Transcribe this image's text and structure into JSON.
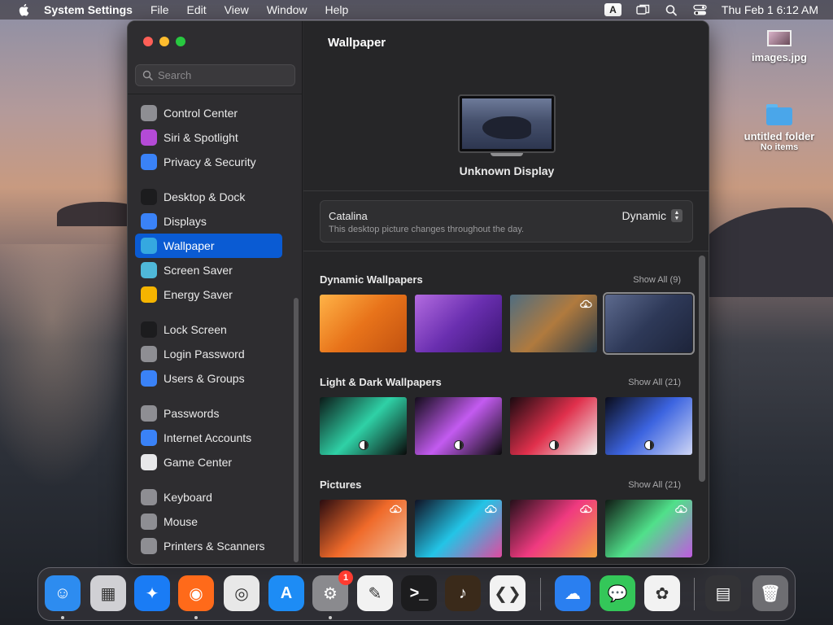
{
  "menubar": {
    "app_name": "System Settings",
    "items": [
      "File",
      "Edit",
      "View",
      "Window",
      "Help"
    ],
    "input_source": "A",
    "clock": "Thu Feb 1  6:12 AM"
  },
  "desktop": {
    "image_file": "images.jpg",
    "folder_name": "untitled folder",
    "folder_sub": "No items"
  },
  "sidebar": {
    "search_placeholder": "Search",
    "items": [
      {
        "label": "Control Center",
        "icon": "toggles-icon",
        "color": "#8e8e93"
      },
      {
        "label": "Siri & Spotlight",
        "icon": "siri-icon",
        "color": "#b44ad6"
      },
      {
        "label": "Privacy & Security",
        "icon": "hand-icon",
        "color": "#3a82f7"
      },
      {
        "label": "Desktop & Dock",
        "icon": "dock-icon",
        "color": "#1c1c1e"
      },
      {
        "label": "Displays",
        "icon": "sun-icon",
        "color": "#3a82f7"
      },
      {
        "label": "Wallpaper",
        "icon": "flower-icon",
        "color": "#35a8e0",
        "active": true
      },
      {
        "label": "Screen Saver",
        "icon": "screen-saver-icon",
        "color": "#4fb8d8"
      },
      {
        "label": "Energy Saver",
        "icon": "bulb-icon",
        "color": "#f5b400"
      },
      {
        "label": "Lock Screen",
        "icon": "lock-icon",
        "color": "#1c1c1e"
      },
      {
        "label": "Login Password",
        "icon": "lock-icon",
        "color": "#8e8e93"
      },
      {
        "label": "Users & Groups",
        "icon": "users-icon",
        "color": "#3a82f7"
      },
      {
        "label": "Passwords",
        "icon": "key-icon",
        "color": "#8e8e93"
      },
      {
        "label": "Internet Accounts",
        "icon": "at-icon",
        "color": "#3a82f7"
      },
      {
        "label": "Game Center",
        "icon": "game-center-icon",
        "color": "#e8e8ea"
      },
      {
        "label": "Keyboard",
        "icon": "keyboard-icon",
        "color": "#8e8e93"
      },
      {
        "label": "Mouse",
        "icon": "mouse-icon",
        "color": "#8e8e93"
      },
      {
        "label": "Printers & Scanners",
        "icon": "printer-icon",
        "color": "#8e8e93"
      }
    ]
  },
  "main": {
    "title": "Wallpaper",
    "display_name": "Unknown Display",
    "current": {
      "name": "Catalina",
      "description": "This desktop picture changes throughout the day.",
      "mode": "Dynamic"
    },
    "sections": [
      {
        "title": "Dynamic Wallpapers",
        "show_all": "Show All (9)",
        "thumbs": [
          {
            "name": "ventura-orange",
            "colors": [
              "#ffb347",
              "#e8731a",
              "#c25210"
            ]
          },
          {
            "name": "monterey-purple",
            "colors": [
              "#b36be0",
              "#6a2fb0",
              "#3a1472"
            ]
          },
          {
            "name": "big-sur-coast",
            "colors": [
              "#4f6d80",
              "#b07a3e",
              "#283a48"
            ],
            "download": true
          },
          {
            "name": "catalina",
            "colors": [
              "#5d6a8e",
              "#2e3958",
              "#1d243a"
            ],
            "selected": true
          }
        ]
      },
      {
        "title": "Light & Dark Wallpapers",
        "show_all": "Show All (21)",
        "thumbs": [
          {
            "name": "mac-pro-green",
            "colors": [
              "#0c1a18",
              "#2fd1a6",
              "#0a0a0a"
            ],
            "mode": true
          },
          {
            "name": "mac-pro-purple",
            "colors": [
              "#130c1a",
              "#c35bf0",
              "#0a0a0a"
            ],
            "mode": true
          },
          {
            "name": "ribbon-red",
            "colors": [
              "#1a0a10",
              "#e0304c",
              "#f0f0f0"
            ],
            "mode": true
          },
          {
            "name": "ribbon-blue",
            "colors": [
              "#0a0c1a",
              "#3c64e0",
              "#cfd6f5"
            ],
            "mode": true
          }
        ]
      },
      {
        "title": "Pictures",
        "show_all": "Show All (21)",
        "thumbs": [
          {
            "name": "mbp-orange",
            "colors": [
              "#2a0c10",
              "#f06a2a",
              "#f0c0a0"
            ],
            "download": true
          },
          {
            "name": "mbp-teal",
            "colors": [
              "#101224",
              "#23c4e6",
              "#e04aa0"
            ],
            "download": true
          },
          {
            "name": "mbp-pink",
            "colors": [
              "#24101a",
              "#f03a80",
              "#f0a040"
            ],
            "download": true
          },
          {
            "name": "mbp-green",
            "colors": [
              "#101a14",
              "#50e08a",
              "#c05ae0"
            ],
            "download": true
          }
        ]
      }
    ]
  },
  "dock": {
    "apps": [
      {
        "name": "finder-icon",
        "color": "#2d8cf0",
        "glyph": "☺",
        "dot": true
      },
      {
        "name": "launchpad-icon",
        "color": "#d0d0d4",
        "glyph": "▦",
        "dot": false
      },
      {
        "name": "safari-icon",
        "color": "#1a7cf5",
        "glyph": "✦",
        "dot": false
      },
      {
        "name": "firefox-icon",
        "color": "#ff6a1a",
        "glyph": "◉",
        "dot": true
      },
      {
        "name": "chrome-icon",
        "color": "#e8e8e8",
        "glyph": "◎",
        "dot": false
      },
      {
        "name": "app-store-icon",
        "color": "#1d8cf5",
        "glyph": "A",
        "dot": false
      },
      {
        "name": "system-settings-icon",
        "color": "#8a8a8e",
        "glyph": "⚙",
        "dot": true,
        "badge": "1"
      },
      {
        "name": "textedit-icon",
        "color": "#f2f2f2",
        "glyph": "✎",
        "dot": false
      },
      {
        "name": "terminal-icon",
        "color": "#1c1c1e",
        "glyph": ">_",
        "dot": false
      },
      {
        "name": "garageband-icon",
        "color": "#3a2a1a",
        "glyph": "♪",
        "dot": false
      },
      {
        "name": "vscode-icon",
        "color": "#f2f2f2",
        "glyph": "❮❯",
        "dot": false
      },
      {
        "name": "weather-icon",
        "color": "#2a7ff0",
        "glyph": "☁",
        "dot": false
      },
      {
        "name": "messages-icon",
        "color": "#34c759",
        "glyph": "💬",
        "dot": false
      },
      {
        "name": "photos-icon",
        "color": "#f2f2f2",
        "glyph": "✿",
        "dot": false
      },
      {
        "name": "downloads-stack-icon",
        "color": "#333336",
        "glyph": "▤",
        "dot": false
      },
      {
        "name": "trash-icon",
        "color": "#6e6e72",
        "glyph": "🗑",
        "dot": false
      }
    ]
  },
  "colors": {
    "accent": "#0a5bd3",
    "window_bg": "#262628",
    "sidebar_bg": "#2e2d30"
  }
}
